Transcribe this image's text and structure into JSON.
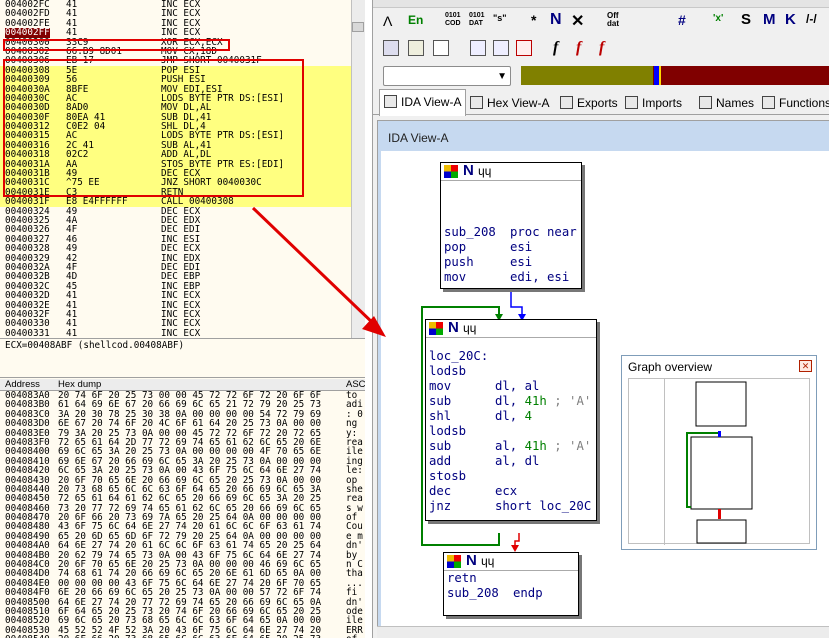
{
  "disasm": {
    "rows": [
      {
        "addr": "004002FC",
        "hex": "41",
        "ins": "INC ECX"
      },
      {
        "addr": "004002FD",
        "hex": "41",
        "ins": "INC ECX"
      },
      {
        "addr": "004002FE",
        "hex": "41",
        "ins": "INC ECX"
      },
      {
        "addr": "004002FF",
        "hex": "41",
        "ins": "INC ECX",
        "bp": true
      },
      {
        "addr": "00400300",
        "hex": "33C9",
        "ins": "XOR ECX,ECX"
      },
      {
        "addr": "00400302",
        "hex": "66:B9 8D01",
        "ins": "MOV CX,18D"
      },
      {
        "addr": "00400306",
        "hex": "EB 17",
        "ins": "JMP SHORT 0040031F"
      },
      {
        "addr": "00400308",
        "hex": "5E",
        "ins": "POP ESI",
        "sel": true
      },
      {
        "addr": "00400309",
        "hex": "56",
        "ins": "PUSH ESI",
        "sel": true
      },
      {
        "addr": "0040030A",
        "hex": "8BFE",
        "ins": "MOV EDI,ESI",
        "sel": true
      },
      {
        "addr": "0040030C",
        "hex": "AC",
        "ins": "LODS BYTE PTR DS:[ESI]",
        "sel": true
      },
      {
        "addr": "0040030D",
        "hex": "8AD0",
        "ins": "MOV DL,AL",
        "sel": true
      },
      {
        "addr": "0040030F",
        "hex": "80EA 41",
        "ins": "SUB DL,41",
        "sel": true
      },
      {
        "addr": "00400312",
        "hex": "C0E2 04",
        "ins": "SHL DL,4",
        "sel": true
      },
      {
        "addr": "00400315",
        "hex": "AC",
        "ins": "LODS BYTE PTR DS:[ESI]",
        "sel": true
      },
      {
        "addr": "00400316",
        "hex": "2C 41",
        "ins": "SUB AL,41",
        "sel": true
      },
      {
        "addr": "00400318",
        "hex": "02C2",
        "ins": "ADD AL,DL",
        "sel": true
      },
      {
        "addr": "0040031A",
        "hex": "AA",
        "ins": "STOS BYTE PTR ES:[EDI]",
        "sel": true
      },
      {
        "addr": "0040031B",
        "hex": "49",
        "ins": "DEC ECX",
        "sel": true
      },
      {
        "addr": "0040031C",
        "hex": "^75 EE",
        "ins": "JNZ SHORT 0040030C",
        "sel": true
      },
      {
        "addr": "0040031E",
        "hex": "C3",
        "ins": "RETN",
        "sel": true
      },
      {
        "addr": "0040031F",
        "hex": "E8 E4FFFFFF",
        "ins": "CALL 00400308",
        "sel": true
      },
      {
        "addr": "00400324",
        "hex": "49",
        "ins": "DEC ECX"
      },
      {
        "addr": "00400325",
        "hex": "4A",
        "ins": "DEC EDX"
      },
      {
        "addr": "00400326",
        "hex": "4F",
        "ins": "DEC EDI"
      },
      {
        "addr": "00400327",
        "hex": "46",
        "ins": "INC ESI"
      },
      {
        "addr": "00400328",
        "hex": "49",
        "ins": "DEC ECX"
      },
      {
        "addr": "00400329",
        "hex": "42",
        "ins": "INC EDX"
      },
      {
        "addr": "0040032A",
        "hex": "4F",
        "ins": "DEC EDI"
      },
      {
        "addr": "0040032B",
        "hex": "4D",
        "ins": "DEC EBP"
      },
      {
        "addr": "0040032C",
        "hex": "45",
        "ins": "INC EBP"
      },
      {
        "addr": "0040032D",
        "hex": "41",
        "ins": "INC ECX"
      },
      {
        "addr": "0040032E",
        "hex": "41",
        "ins": "INC ECX"
      },
      {
        "addr": "0040032F",
        "hex": "41",
        "ins": "INC ECX"
      },
      {
        "addr": "00400330",
        "hex": "41",
        "ins": "INC ECX"
      },
      {
        "addr": "00400331",
        "hex": "41",
        "ins": "INC ECX"
      },
      {
        "addr": "00400332",
        "hex": "41",
        "ins": "INC ECX"
      },
      {
        "addr": "00400333",
        "hex": "41",
        "ins": "INC ECX"
      }
    ]
  },
  "info_line": "ECX=00408ABF (shellcod.00408ABF)",
  "dump": {
    "col_address": "Address",
    "col_hex": "Hex dump",
    "col_ascii": "ASC",
    "rows": [
      {
        "addr": "004083A0",
        "hex": "20 74 6F 20 25 73 00 00 45 72 72 6F 72 20 6F 6F",
        "asc": "to"
      },
      {
        "addr": "004083B0",
        "hex": "61 64 69 6E 67 20 66 69 6C 65 21 72 79 20 25 73",
        "asc": "adi"
      },
      {
        "addr": "004083C0",
        "hex": "3A 20 30 78 25 30 38 0A 00 00 00 00 54 72 79 69",
        "asc": ": 0"
      },
      {
        "addr": "004083D0",
        "hex": "6E 67 20 74 6F 20 4C 6F 61 64 20 25 73 0A 00 00",
        "asc": "ng"
      },
      {
        "addr": "004083E0",
        "hex": "79 3A 20 25 73 0A 00 00 45 72 72 6F 72 20 72 65",
        "asc": "y:"
      },
      {
        "addr": "004083F0",
        "hex": "72 65 61 64 2D 77 72 69 74 65 61 62 6C 65 20 6E",
        "asc": "rea"
      },
      {
        "addr": "00408400",
        "hex": "69 6C 65 3A 20 25 73 0A 00 00 00 00 4F 70 65 6E",
        "asc": "ile"
      },
      {
        "addr": "00408410",
        "hex": "69 6E 67 20 66 69 6C 65 3A 20 25 73 0A 00 00 00",
        "asc": "ing"
      },
      {
        "addr": "00408420",
        "hex": "6C 65 3A 20 25 73 0A 00 43 6F 75 6C 64 6E 27 74",
        "asc": "le:"
      },
      {
        "addr": "00408430",
        "hex": "20 6F 70 65 6E 20 66 69 6C 65 20 25 73 0A 00 00",
        "asc": "op"
      },
      {
        "addr": "00408440",
        "hex": "20 73 68 65 6C 6C 63 6F 64 65 20 66 69 6C 65 3A",
        "asc": "she"
      },
      {
        "addr": "00408450",
        "hex": "72 65 61 64 61 62 6C 65 20 66 69 6C 65 3A 20 25",
        "asc": "rea"
      },
      {
        "addr": "00408460",
        "hex": "73 20 77 72 69 74 65 61 62 6C 65 20 66 69 6C 65",
        "asc": "s w"
      },
      {
        "addr": "00408470",
        "hex": "20 6F 66 20 73 69 7A 65 20 25 64 0A 00 00 00 00",
        "asc": "of"
      },
      {
        "addr": "00408480",
        "hex": "43 6F 75 6C 64 6E 27 74 20 61 6C 6C 6F 63 61 74",
        "asc": "Cou"
      },
      {
        "addr": "00408490",
        "hex": "65 20 6D 65 6D 6F 72 79 20 25 64 0A 00 00 00 00",
        "asc": "e m"
      },
      {
        "addr": "004084A0",
        "hex": "64 6E 27 74 20 61 6C 6C 6F 63 61 74 65 20 25 64",
        "asc": "dn'"
      },
      {
        "addr": "004084B0",
        "hex": "20 62 79 74 65 73 0A 00 43 6F 75 6C 64 6E 27 74",
        "asc": "by"
      },
      {
        "addr": "004084C0",
        "hex": "20 6F 70 65 6E 20 25 73 0A 00 00 00 46 69 6C 65",
        "asc": "n C"
      },
      {
        "addr": "004084D0",
        "hex": "74 68 61 74 20 66 69 6C 65 20 6E 61 6D 65 0A 00",
        "asc": "tha"
      },
      {
        "addr": "004084E0",
        "hex": "00 00 00 00 43 6F 75 6C 64 6E 27 74 20 6F 70 65",
        "asc": "..."
      },
      {
        "addr": "004084F0",
        "hex": "6E 20 66 69 6C 65 20 25 73 0A 00 00 57 72 6F 74",
        "asc": "fi"
      },
      {
        "addr": "00408500",
        "hex": "64 6E 27 74 20 77 72 69 74 65 20 66 69 6C 65 0A",
        "asc": "dn'"
      },
      {
        "addr": "00408510",
        "hex": "6F 64 65 20 25 73 20 74 6F 20 66 69 6C 65 20 25",
        "asc": "ode"
      },
      {
        "addr": "00408520",
        "hex": "69 6C 65 20 73 68 65 6C 6C 63 6F 64 65 0A 00 00",
        "asc": "ile"
      },
      {
        "addr": "00408530",
        "hex": "45 52 52 4F 52 3A 20 43 6F 75 6C 64 6E 27 74 20",
        "asc": "ERR"
      },
      {
        "addr": "00408540",
        "hex": "20 6F 66 20 73 68 65 6C 6C 63 6F 64 65 20 25 73",
        "asc": "of"
      }
    ]
  },
  "toolbar": {
    "en_label": "En",
    "code_label": "0101 COD",
    "dat_label": "0101 DAT",
    "off_label": "Off dat",
    "n_label": "N",
    "s_label": "S",
    "m_label": "M",
    "k_label": "K",
    "f_label": "f"
  },
  "tabs": [
    {
      "label": "IDA View-A",
      "active": true
    },
    {
      "label": "Hex View-A"
    },
    {
      "label": "Exports"
    },
    {
      "label": "Imports"
    },
    {
      "label": "Names"
    },
    {
      "label": "Functions"
    }
  ],
  "ida_title": "IDA View-A",
  "nodes": {
    "n1": {
      "lines": [
        {
          "mn": "sub_208",
          "op": "proc near"
        },
        {
          "mn": "pop",
          "op": "esi"
        },
        {
          "mn": "push",
          "op": "esi"
        },
        {
          "mn": "mov",
          "op": "edi, esi"
        }
      ]
    },
    "n2": {
      "label": "loc_20C:",
      "lines": [
        {
          "mn": "lodsb",
          "op": ""
        },
        {
          "mn": "mov",
          "op": "dl, al"
        },
        {
          "mn": "sub",
          "op": "dl, ",
          "num": "41h",
          "cm": " ; 'A'"
        },
        {
          "mn": "shl",
          "op": "dl, ",
          "num": "4"
        },
        {
          "mn": "lodsb",
          "op": ""
        },
        {
          "mn": "sub",
          "op": "al, ",
          "num": "41h",
          "cm": " ; 'A'"
        },
        {
          "mn": "add",
          "op": "al, dl"
        },
        {
          "mn": "stosb",
          "op": ""
        },
        {
          "mn": "dec",
          "op": "ecx"
        },
        {
          "mn": "jnz",
          "op": "short loc_20C"
        }
      ]
    },
    "n3": {
      "lines": [
        {
          "mn": "retn",
          "op": ""
        },
        {
          "mn": "sub_208",
          "op": "endp"
        }
      ]
    }
  },
  "overview": {
    "title": "Graph overview"
  },
  "colors": {
    "breakpoint": "#800000",
    "selection": "#ffff80",
    "highlight_border": "#e00000",
    "arrow": "#e00000",
    "graph_bg": "#c6d9f0",
    "code_text": "#000080",
    "code_number": "#008000",
    "edge_green": "#008000",
    "edge_blue": "#0000ff",
    "edge_red": "#e00000"
  }
}
